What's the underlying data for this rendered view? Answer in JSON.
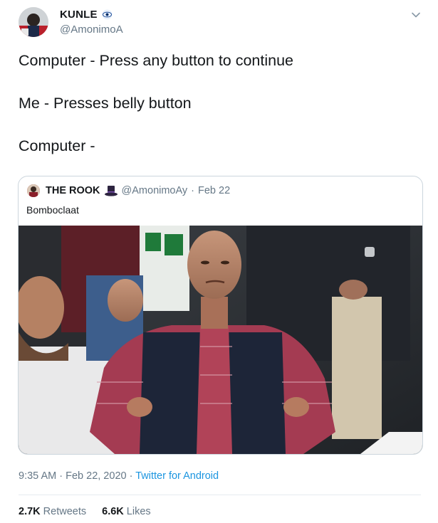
{
  "author": {
    "display_name": "KUNLE",
    "handle": "@AmonimoA",
    "verified_icon": "eye-badge-icon"
  },
  "menu": {
    "icon": "chevron-down-icon"
  },
  "tweet": {
    "lines": [
      "Computer - Press any button to continue",
      "Me - Presses belly button",
      "Computer -"
    ]
  },
  "quote": {
    "display_name": "THE ROOK",
    "emoji_icon": "top-hat-icon",
    "handle": "@AmonimoAy",
    "separator": "·",
    "date": "Feb 22",
    "text": "Bomboclaat",
    "media": "photo-man-hands-on-hips-in-crowd"
  },
  "meta": {
    "time": "9:35 AM",
    "separator": "·",
    "date": "Feb 22, 2020",
    "separator2": "·",
    "source": "Twitter for Android"
  },
  "stats": {
    "retweets_count": "2.7K",
    "retweets_label": "Retweets",
    "likes_count": "6.6K",
    "likes_label": "Likes"
  },
  "colors": {
    "link": "#1b95e0",
    "secondary_text": "#657786",
    "border": "#ccd6dd"
  }
}
